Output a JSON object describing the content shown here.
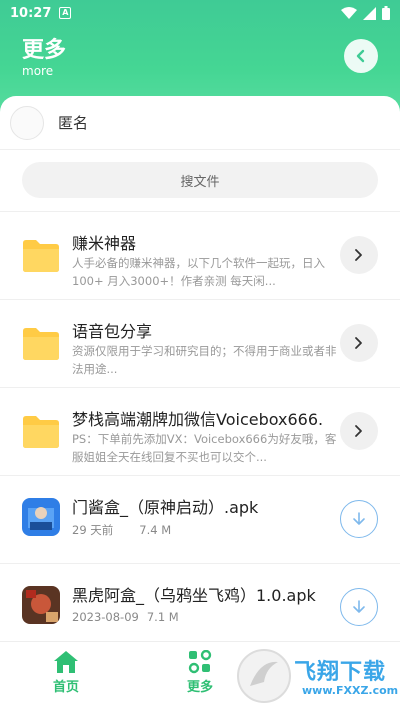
{
  "status_bar": {
    "time": "10:27",
    "notification_letter": "A"
  },
  "header": {
    "title": "更多",
    "subtitle": "more"
  },
  "user": {
    "name": "匿名"
  },
  "search": {
    "placeholder": "搜文件"
  },
  "folders": [
    {
      "name": "赚米神器",
      "desc": "人手必备的赚米神器，以下几个软件一起玩，日入100+ 月入3000+！作者亲测 每天闲..."
    },
    {
      "name": "语音包分享",
      "desc": "资源仅限用于学习和研究目的；不得用于商业或者非法用途..."
    },
    {
      "name": "梦栈高端潮牌加微信Voicebox666.",
      "desc": "PS：下单前先添加VX：Voicebox666为好友哦，客服姐姐全天在线回复不买也可以交个..."
    }
  ],
  "files": [
    {
      "name": "门酱盒_（原神启动）.apk",
      "date": "29 天前",
      "size": "7.4 M"
    },
    {
      "name": "黑虎阿盒_（乌鸦坐飞鸡）1.0.apk",
      "date": "2023-08-09",
      "size": "7.1 M"
    }
  ],
  "tabs": [
    {
      "label": "首页"
    },
    {
      "label": "更多"
    }
  ],
  "watermark": {
    "text": "飞翔下载",
    "url": "www.FXXZ.com"
  },
  "colors": {
    "accent": "#2fbf74",
    "header_gradient": "#45d694",
    "folder": "#ffcb45",
    "download": "#7fb9ec"
  }
}
